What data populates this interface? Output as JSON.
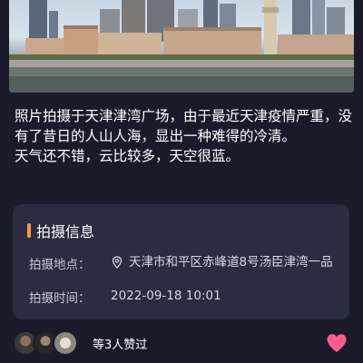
{
  "post": {
    "paragraphs": [
      "照片拍摄于天津津湾广场，由于最近天津疫情严重，没有了昔日的人山人海，显出一种难得的冷清。",
      "天气还不错，云比较多，天空很蓝。"
    ]
  },
  "info_card": {
    "title": "拍摄信息",
    "location_label": "拍摄地点：",
    "location_value": "天津市和平区赤峰道8号汤臣津湾一品",
    "time_label": "拍摄时间：",
    "time_value": "2022-09-18 10:01",
    "location_icon": "location-pin-icon"
  },
  "likes": {
    "text": "等3人赞过",
    "avatar_count": 3,
    "heart_icon": "heart-icon"
  },
  "colors": {
    "background": "#1b1a2b",
    "card": "#2b2b42",
    "accent": "#ff9a3c",
    "heart": "#ff5c8a"
  }
}
